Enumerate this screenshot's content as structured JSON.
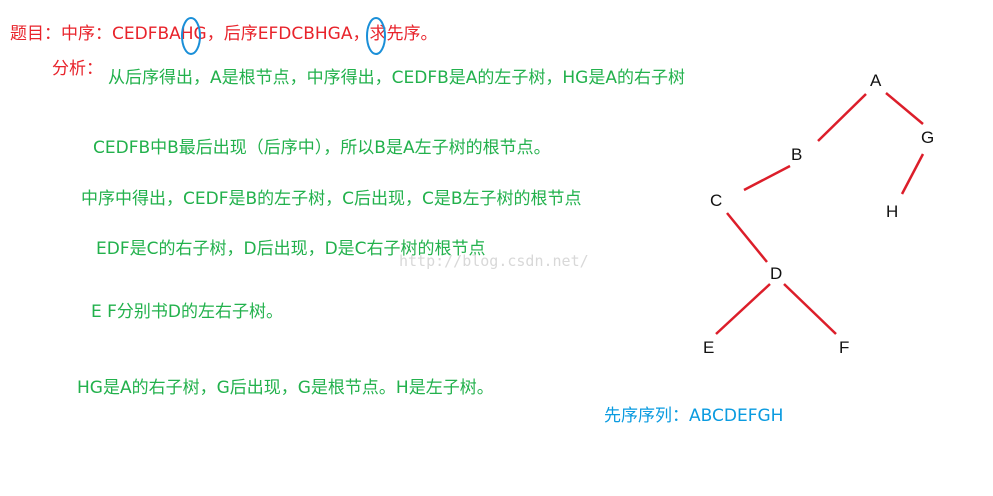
{
  "colors": {
    "title": "#e8232b",
    "analysis": "#22b14c",
    "answer": "#0a9be0",
    "edge": "#dc1e2a",
    "circle": "#1a8fd8"
  },
  "title": "题目：中序：CEDFBAHG，后序EFDCBHGA，求先序。",
  "analysis_label": "分析：",
  "lines": [
    "从后序得出，A是根节点，中序得出，CEDFB是A的左子树，HG是A的右子树",
    "CEDFB中B最后出现（后序中），所以B是A左子树的根节点。",
    "中序中得出，CEDF是B的左子树，C后出现，C是B左子树的根节点",
    "EDF是C的右子树，D后出现，D是C右子树的根节点",
    "E F分别书D的左右子树。",
    "HG是A的右子树，G后出现，G是根节点。H是左子树。"
  ],
  "watermark": "http://blog.csdn.net/",
  "answer": "先序序列：ABCDEFGH",
  "tree": {
    "nodes": [
      "A",
      "B",
      "G",
      "C",
      "H",
      "D",
      "E",
      "F"
    ],
    "edges": [
      [
        "A",
        "B"
      ],
      [
        "A",
        "G"
      ],
      [
        "B",
        "C"
      ],
      [
        "G",
        "H"
      ],
      [
        "C",
        "D"
      ],
      [
        "D",
        "E"
      ],
      [
        "D",
        "F"
      ]
    ]
  }
}
